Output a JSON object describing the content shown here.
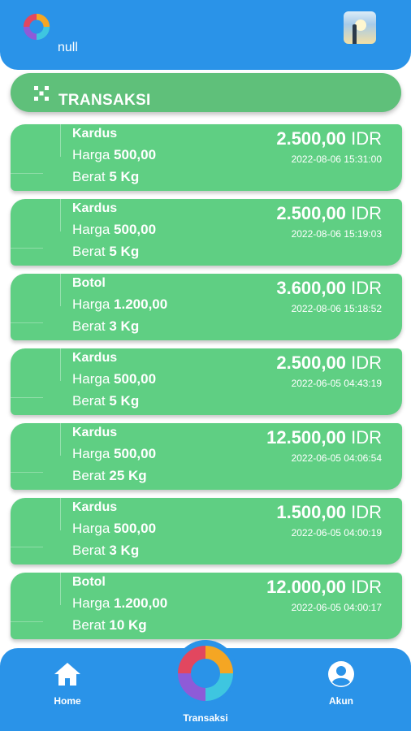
{
  "header": {
    "username": "null",
    "logo_icon": "app-logo-icon",
    "avatar_icon": "profile-photo"
  },
  "section": {
    "title": "TRANSAKSI",
    "icon": "dots-icon"
  },
  "transactions": [
    {
      "name": "Kardus",
      "price_label": "Harga",
      "price": "500,00",
      "weight_label": "Berat",
      "weight": "5 Kg",
      "total": "2.500,00",
      "currency": "IDR",
      "date": "2022-08-06 15:31:00"
    },
    {
      "name": "Kardus",
      "price_label": "Harga",
      "price": "500,00",
      "weight_label": "Berat",
      "weight": "5 Kg",
      "total": "2.500,00",
      "currency": "IDR",
      "date": "2022-08-06 15:19:03"
    },
    {
      "name": "Botol",
      "price_label": "Harga",
      "price": "1.200,00",
      "weight_label": "Berat",
      "weight": "3 Kg",
      "total": "3.600,00",
      "currency": "IDR",
      "date": "2022-08-06 15:18:52"
    },
    {
      "name": "Kardus",
      "price_label": "Harga",
      "price": "500,00",
      "weight_label": "Berat",
      "weight": "5 Kg",
      "total": "2.500,00",
      "currency": "IDR",
      "date": "2022-06-05 04:43:19"
    },
    {
      "name": "Kardus",
      "price_label": "Harga",
      "price": "500,00",
      "weight_label": "Berat",
      "weight": "25 Kg",
      "total": "12.500,00",
      "currency": "IDR",
      "date": "2022-06-05 04:06:54"
    },
    {
      "name": "Kardus",
      "price_label": "Harga",
      "price": "500,00",
      "weight_label": "Berat",
      "weight": "3 Kg",
      "total": "1.500,00",
      "currency": "IDR",
      "date": "2022-06-05 04:00:19"
    },
    {
      "name": "Botol",
      "price_label": "Harga",
      "price": "1.200,00",
      "weight_label": "Berat",
      "weight": "10 Kg",
      "total": "12.000,00",
      "currency": "IDR",
      "date": "2022-06-05 04:00:17"
    }
  ],
  "nav": {
    "home": {
      "label": "Home",
      "icon": "home-icon"
    },
    "transaksi": {
      "label": "Transaksi",
      "icon": "app-logo-icon"
    },
    "akun": {
      "label": "Akun",
      "icon": "account-icon"
    }
  },
  "colors": {
    "primary": "#2a93e8",
    "card": "#5fcf83",
    "section": "#5fc07a",
    "text": "#ffffff"
  }
}
